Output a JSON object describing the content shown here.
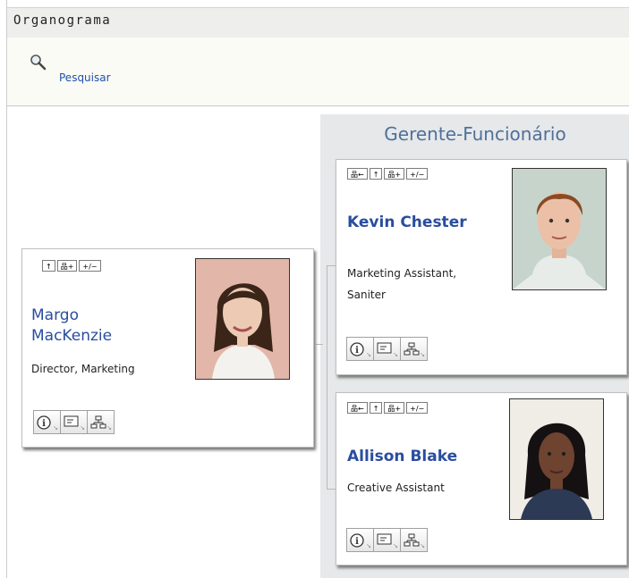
{
  "title": "Organograma",
  "toolbar": {
    "search_label": "Pesquisar",
    "search_icon": "magnifier-icon"
  },
  "relationship_title": "Gerente-Funcionário",
  "colors": {
    "link": "#2a4d9e",
    "heading": "#4f7099",
    "panel": "#e6e8ea"
  },
  "manager": {
    "name_line1": "Margo",
    "name_line2": "MacKenzie",
    "title": "Director, Marketing",
    "buttons": [
      "↑",
      "品+",
      "+/−"
    ]
  },
  "employees": [
    {
      "name": "Kevin Chester",
      "title_line1": "Marketing Assistant,",
      "title_line2": "Saniter",
      "buttons": [
        "品←",
        "↑",
        "品+",
        "+/−"
      ]
    },
    {
      "name": "Allison Blake",
      "title": "Creative Assistant",
      "buttons": [
        "品←",
        "↑",
        "品+",
        "+/−"
      ]
    }
  ],
  "action_icons": [
    "info-icon",
    "contact-card-icon",
    "org-chart-icon"
  ]
}
